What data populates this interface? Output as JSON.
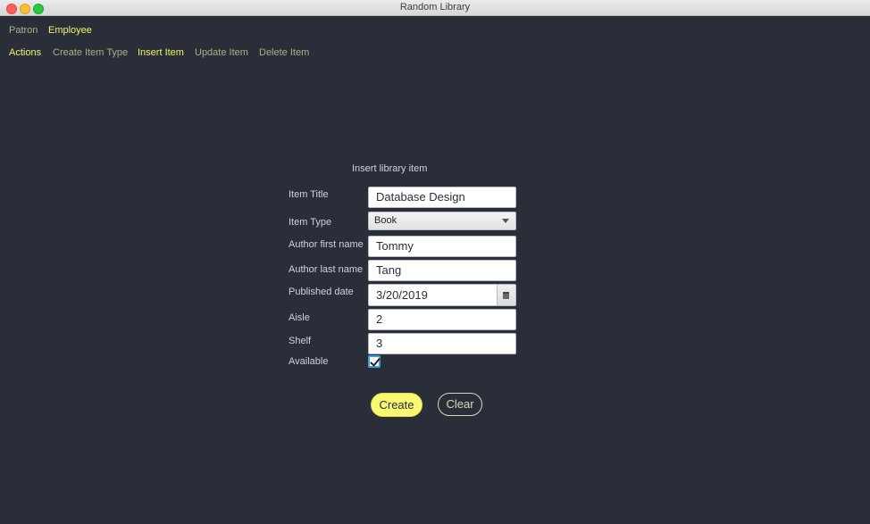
{
  "window": {
    "title": "Random Library"
  },
  "top_tabs": [
    {
      "label": "Patron",
      "active": false
    },
    {
      "label": "Employee",
      "active": true
    }
  ],
  "sub_tabs": [
    {
      "label": "Actions",
      "active": true
    },
    {
      "label": "Create Item Type",
      "active": false
    },
    {
      "label": "Insert Item",
      "active": true
    },
    {
      "label": "Update Item",
      "active": false
    },
    {
      "label": "Delete Item",
      "active": false
    }
  ],
  "form": {
    "title": "Insert library item",
    "item_title": {
      "label": "Item Title",
      "value": "Database Design"
    },
    "item_type": {
      "label": "Item Type",
      "value": "Book"
    },
    "author_first": {
      "label": "Author first name",
      "value": "Tommy"
    },
    "author_last": {
      "label": "Author last name",
      "value": "Tang"
    },
    "published": {
      "label": "Published date",
      "value": "3/20/2019"
    },
    "aisle": {
      "label": "Aisle",
      "value": "2"
    },
    "shelf": {
      "label": "Shelf",
      "value": "3"
    },
    "available": {
      "label": "Available",
      "checked": true
    },
    "create_label": "Create",
    "clear_label": "Clear"
  },
  "colors": {
    "background": "#2a2e38",
    "accent": "#f4f46a",
    "muted_tab": "#a8b18a",
    "checkbox_border": "#3ea2d8"
  }
}
